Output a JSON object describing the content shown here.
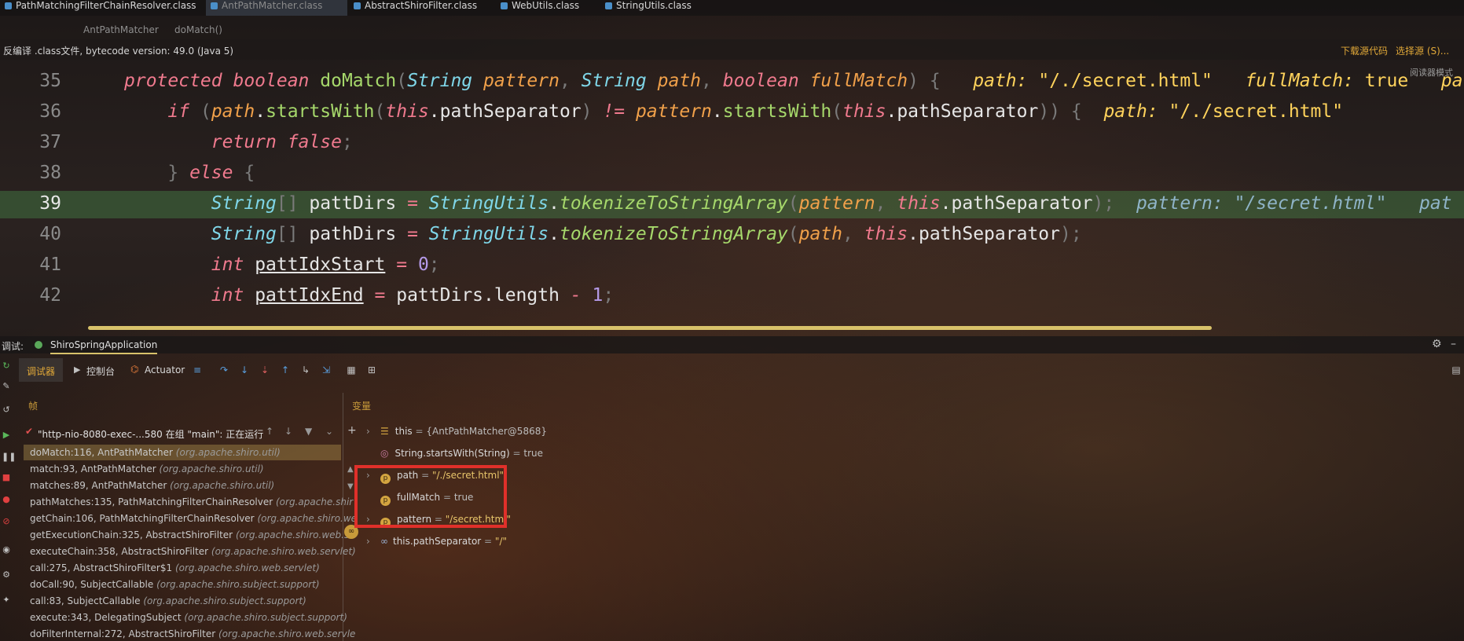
{
  "tabs": [
    "PathMatchingFilterChainResolver.class",
    "AntPathMatcher.class",
    "AbstractShiroFilter.class",
    "WebUtils.class",
    "StringUtils.class"
  ],
  "breadcrumb": [
    "AntPathMatcher",
    "doMatch()"
  ],
  "infobar": {
    "text": "反编译 .class文件, bytecode version: 49.0 (Java 5)",
    "download": "下载源代码",
    "choose": "选择源 (S)..."
  },
  "reader_mode": "阅读器模式",
  "line_numbers": [
    "35",
    "36",
    "37",
    "38",
    "39",
    "40",
    "41",
    "42"
  ],
  "debug": {
    "label": "调试:",
    "config": "ShiroSpringApplication",
    "tabs": [
      "调试器",
      "控制台",
      "Actuator"
    ],
    "frames_header": "帧",
    "vars_header": "变量",
    "thread": "\"http-nio-8080-exec-...580 在组 \"main\": 正在运行",
    "frames": [
      {
        "method": "doMatch:116, AntPathMatcher",
        "pkg": "(org.apache.shiro.util)"
      },
      {
        "method": "match:93, AntPathMatcher",
        "pkg": "(org.apache.shiro.util)"
      },
      {
        "method": "matches:89, AntPathMatcher",
        "pkg": "(org.apache.shiro.util)"
      },
      {
        "method": "pathMatches:135, PathMatchingFilterChainResolver",
        "pkg": "(org.apache.shir"
      },
      {
        "method": "getChain:106, PathMatchingFilterChainResolver",
        "pkg": "(org.apache.shiro.we"
      },
      {
        "method": "getExecutionChain:325, AbstractShiroFilter",
        "pkg": "(org.apache.shiro.web.se"
      },
      {
        "method": "executeChain:358, AbstractShiroFilter",
        "pkg": "(org.apache.shiro.web.servlet)"
      },
      {
        "method": "call:275, AbstractShiroFilter$1",
        "pkg": "(org.apache.shiro.web.servlet)"
      },
      {
        "method": "doCall:90, SubjectCallable",
        "pkg": "(org.apache.shiro.subject.support)"
      },
      {
        "method": "call:83, SubjectCallable",
        "pkg": "(org.apache.shiro.subject.support)"
      },
      {
        "method": "execute:343, DelegatingSubject",
        "pkg": "(org.apache.shiro.subject.support)"
      },
      {
        "method": "doFilterInternal:272, AbstractShiroFilter",
        "pkg": "(org.apache.shiro.web.servle"
      }
    ],
    "variables": [
      {
        "name": "this",
        "value": "{AntPathMatcher@5868}"
      },
      {
        "name": "String.startsWith(String)",
        "value": "true"
      },
      {
        "name": "path",
        "value": "\"/./secret.html\""
      },
      {
        "name": "fullMatch",
        "value": "true"
      },
      {
        "name": "pattern",
        "value": "\"/secret.html\""
      },
      {
        "name": "this.pathSeparator",
        "value": "\"/\""
      }
    ]
  },
  "colors": {
    "highlight": "#46824a",
    "red_box": "#e0302a",
    "accent": "#e0a838"
  }
}
